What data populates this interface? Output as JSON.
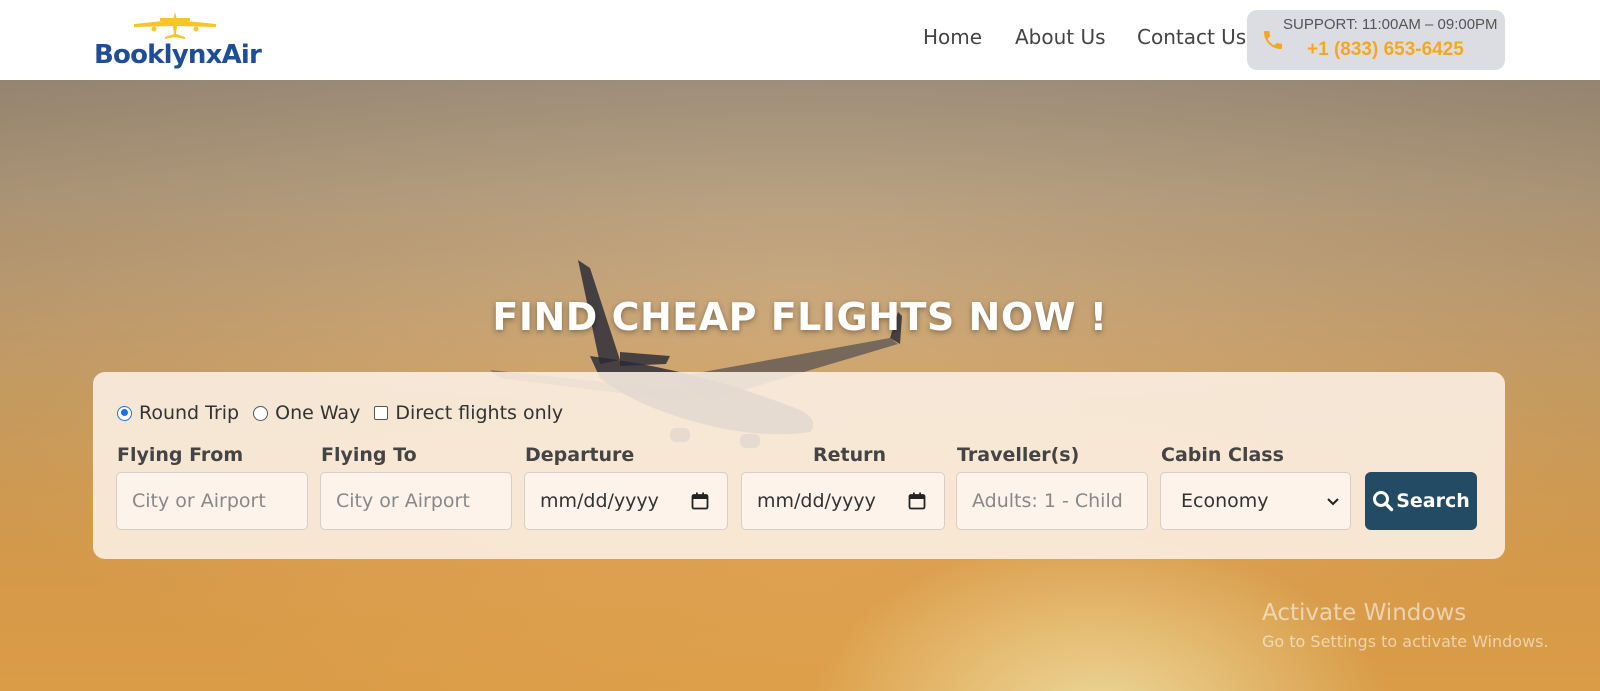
{
  "brand": {
    "name": "BooklynxAir"
  },
  "nav": {
    "items": [
      "Home",
      "About Us",
      "Contact Us"
    ]
  },
  "support": {
    "label": "SUPPORT: 11:00AM – 09:00PM",
    "phone": "+1 (833) 653-6425",
    "accent": "#f5a81c"
  },
  "hero": {
    "title": "FIND CHEAP FLIGHTS NOW !"
  },
  "search": {
    "trip_types": [
      "Round Trip",
      "One Way"
    ],
    "selected_trip": "Round Trip",
    "direct_label": "Direct flights only",
    "direct_checked": false,
    "fields": {
      "from": {
        "label": "Flying From",
        "placeholder": "City or Airport"
      },
      "to": {
        "label": "Flying To",
        "placeholder": "City or Airport"
      },
      "departure": {
        "label": "Departure",
        "value": "mm/dd/yyyy"
      },
      "return": {
        "label": "Return",
        "value": "mm/dd/yyyy"
      },
      "travellers": {
        "label": "Traveller(s)",
        "placeholder": "Adults: 1 - Child"
      },
      "cabin": {
        "label": "Cabin Class",
        "value": "Economy"
      }
    },
    "button_label": "Search",
    "button_color": "#234b63"
  },
  "watermark": {
    "line1": "Activate Windows",
    "line2": "Go to Settings to activate Windows."
  }
}
